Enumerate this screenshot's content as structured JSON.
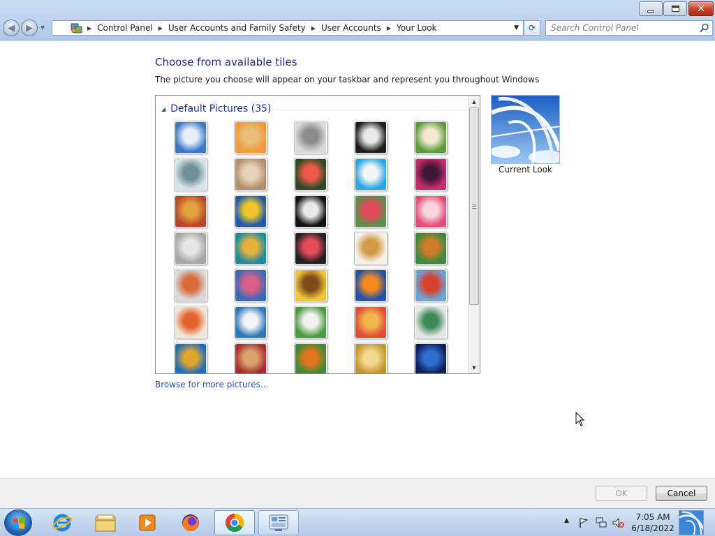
{
  "window": {
    "min_label": "minimize",
    "max_label": "maximize",
    "close_label": "close"
  },
  "address": {
    "crumbs": [
      "Control Panel",
      "User Accounts and Family Safety",
      "User Accounts",
      "Your Look"
    ]
  },
  "search": {
    "placeholder": "Search Control Panel"
  },
  "content": {
    "heading": "Choose from available tiles",
    "subtext": "The picture you choose will appear on your taskbar and represent you throughout Windows",
    "group_title": "Default Pictures (35)",
    "current_label": "Current Look",
    "browse_link": "Browse for more pictures..."
  },
  "tiles": [
    {
      "name": "rollercoaster",
      "c1": "#3a78c8",
      "c2": "#e6f0fb"
    },
    {
      "name": "starfish",
      "c1": "#f09a3b",
      "c2": "#e8c07a"
    },
    {
      "name": "robot-toy",
      "c1": "#d9d9d9",
      "c2": "#8c8c8c"
    },
    {
      "name": "record-player",
      "c1": "#1c1c1c",
      "c2": "#e8e8e8"
    },
    {
      "name": "lucky-cat",
      "c1": "#5a9c3a",
      "c2": "#f4e9cf"
    },
    {
      "name": "gyroscope",
      "c1": "#d5e2e6",
      "c2": "#6e8e99"
    },
    {
      "name": "kitten",
      "c1": "#b58f6a",
      "c2": "#e5d2b8"
    },
    {
      "name": "flower",
      "c1": "#2c4b23",
      "c2": "#ef5a47"
    },
    {
      "name": "pinwheel",
      "c1": "#2aa6e4",
      "c2": "#f5f5f5"
    },
    {
      "name": "ball",
      "c1": "#c82b6b",
      "c2": "#401735"
    },
    {
      "name": "textiles",
      "c1": "#b9462a",
      "c2": "#e3a23d"
    },
    {
      "name": "leaf",
      "c1": "#1e5aa8",
      "c2": "#f1c52a"
    },
    {
      "name": "dog",
      "c1": "#111111",
      "c2": "#e9e9e9"
    },
    {
      "name": "crayons",
      "c1": "#5b8f4a",
      "c2": "#e3485a"
    },
    {
      "name": "star-ornament",
      "c1": "#e84b76",
      "c2": "#f7d5df"
    },
    {
      "name": "jacks",
      "c1": "#a7a7a7",
      "c2": "#e7e7e7"
    },
    {
      "name": "stairs",
      "c1": "#1f8aa0",
      "c2": "#e5b03e"
    },
    {
      "name": "origami-crane",
      "c1": "#202020",
      "c2": "#e44d58"
    },
    {
      "name": "guitar",
      "c1": "#f6f1e8",
      "c2": "#d29946"
    },
    {
      "name": "pomeranian",
      "c1": "#3b8a3d",
      "c2": "#d17b2a"
    },
    {
      "name": "robot",
      "c1": "#d9d9d9",
      "c2": "#d86a37"
    },
    {
      "name": "fabric",
      "c1": "#3b69b4",
      "c2": "#d9608a"
    },
    {
      "name": "sunflower",
      "c1": "#f2c53a",
      "c2": "#7b4b1a"
    },
    {
      "name": "fish",
      "c1": "#2250a6",
      "c2": "#f18c1c"
    },
    {
      "name": "balloon",
      "c1": "#6aa5d8",
      "c2": "#d9412c"
    },
    {
      "name": "doll",
      "c1": "#f0e6d8",
      "c2": "#e4622d"
    },
    {
      "name": "sailboat",
      "c1": "#2d78b7",
      "c2": "#f3f3f3"
    },
    {
      "name": "soccer-ball",
      "c1": "#4a9a3f",
      "c2": "#f2f2f2"
    },
    {
      "name": "colorful-wall",
      "c1": "#e44a38",
      "c2": "#f0b84a"
    },
    {
      "name": "marbles",
      "c1": "#e6e6e6",
      "c2": "#3d8a59"
    },
    {
      "name": "window",
      "c1": "#1d6ec0",
      "c2": "#e2a32b"
    },
    {
      "name": "rug",
      "c1": "#a82e2e",
      "c2": "#d7a26b"
    },
    {
      "name": "butterfly",
      "c1": "#3e8a36",
      "c2": "#e0761c"
    },
    {
      "name": "basket",
      "c1": "#c6952f",
      "c2": "#f1d98f"
    },
    {
      "name": "lighthouse",
      "c1": "#0d1f5c",
      "c2": "#2f6fd0"
    }
  ],
  "buttons": {
    "ok": "OK",
    "cancel": "Cancel"
  },
  "taskbar": {
    "items": [
      "internet-explorer",
      "file-explorer",
      "media-player",
      "firefox",
      "chrome",
      "control-panel"
    ],
    "time": "7:05 AM",
    "date": "6/18/2022"
  }
}
